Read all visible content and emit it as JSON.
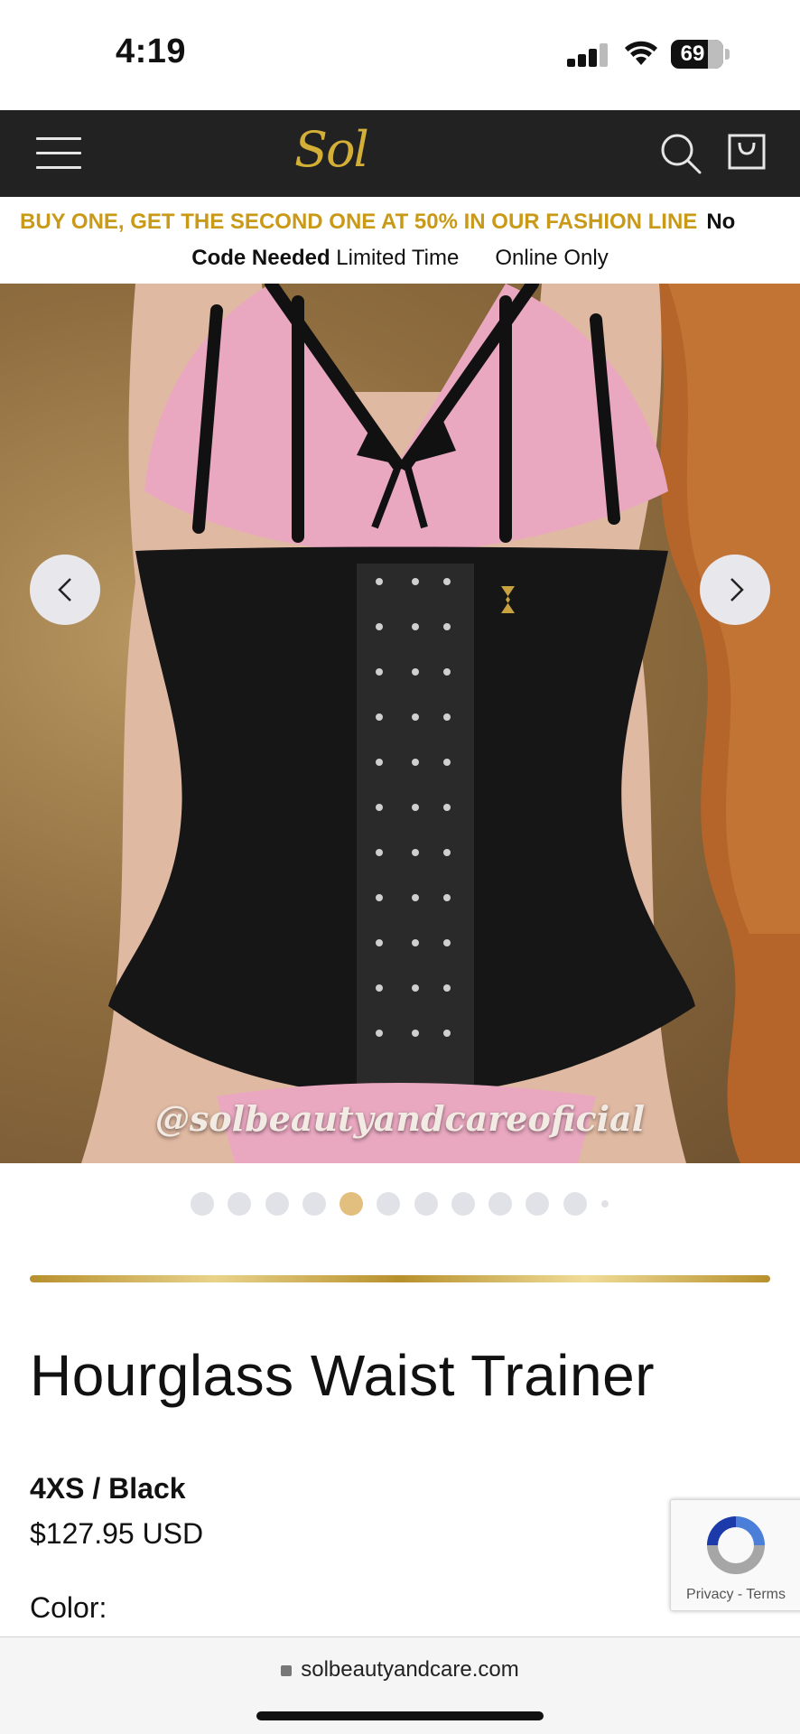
{
  "status_bar": {
    "time": "4:19",
    "battery": "69"
  },
  "header": {
    "logo": "Sol"
  },
  "promo": {
    "line1_highlight": "BUY ONE, GET THE SECOND ONE AT 50% IN OUR FASHION LINE",
    "line1_tail": "No",
    "line2_bold": "Code Needed",
    "line2_rest": "Limited Time",
    "line2_extra": "Online Only"
  },
  "gallery": {
    "watermark": "@solbeautyandcareoficial",
    "total_slides": 12,
    "active_index": 4
  },
  "product": {
    "title": "Hourglass Waist Trainer",
    "variant": "4XS / Black",
    "price": "$127.95 USD",
    "color_label": "Color:"
  },
  "recaptcha": {
    "links": "Privacy - Terms"
  },
  "browser": {
    "url": "solbeautyandcare.com"
  },
  "colors": {
    "header_bg": "#222222",
    "gold": "#c99a18",
    "dot_active": "#e3bf7f"
  }
}
